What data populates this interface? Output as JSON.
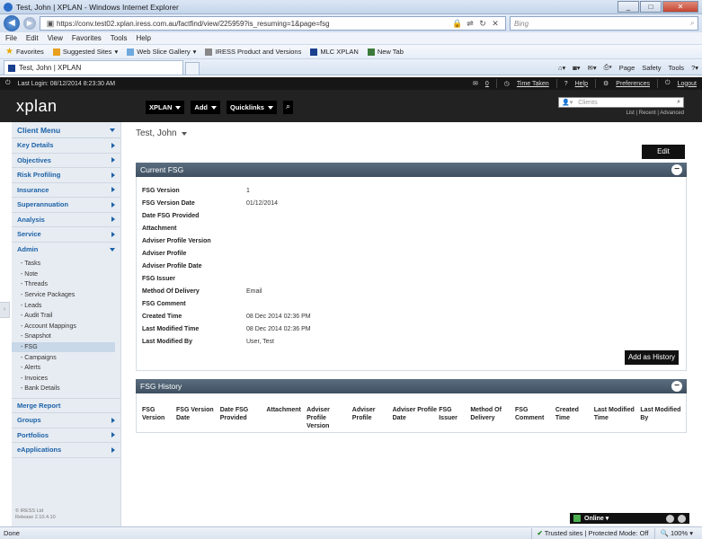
{
  "browser": {
    "title": "Test, John | XPLAN - Windows Internet Explorer",
    "url": "https://conv.test02.xplan.iress.com.au/factfind/view/225959?is_resuming=1&page=fsg",
    "search_placeholder": "Bing",
    "menu": [
      "File",
      "Edit",
      "View",
      "Favorites",
      "Tools",
      "Help"
    ],
    "favorites_label": "Favorites",
    "favorites": [
      "Suggested Sites",
      "Web Slice Gallery",
      "IRESS Product and Versions",
      "MLC XPLAN",
      "New Tab"
    ],
    "tab_title": "Test, John | XPLAN",
    "toolbar": [
      "Page",
      "Safety",
      "Tools"
    ],
    "status_left": "Done",
    "status_zone": "Trusted sites | Protected Mode: Off",
    "zoom": "100%"
  },
  "app": {
    "last_login": "Last Login: 08/12/2014 8:23:30 AM",
    "mail_count": "0",
    "time_taken": "Time Taken",
    "help": "Help",
    "preferences": "Preferences",
    "logout": "Logout",
    "logo": "xplan",
    "nav": [
      "XPLAN",
      "Add",
      "Quicklinks"
    ],
    "client_search_placeholder": "Clients",
    "search_links": "List  |  Recent  |  Advanced",
    "copyright": "© IRESS Ltd",
    "release": "Release 2.10.4.10",
    "online": "Online"
  },
  "sidebar": {
    "header": "Client Menu",
    "items_top": [
      "Key Details",
      "Objectives",
      "Risk Profiling",
      "Insurance",
      "Superannuation",
      "Analysis",
      "Service"
    ],
    "admin": "Admin",
    "admin_sub": [
      "Tasks",
      "Note",
      "Threads",
      "Service Packages",
      "Leads",
      "Audit Trail",
      "Account Mappings",
      "Snapshot",
      "FSG",
      "Campaigns",
      "Alerts",
      "Invoices",
      "Bank Details"
    ],
    "active_sub": "FSG",
    "merge_report": "Merge Report",
    "items_bottom": [
      "Groups",
      "Portfolios",
      "eApplications"
    ]
  },
  "main": {
    "client_name": "Test, John",
    "edit_label": "Edit",
    "current_fsg_title": "Current FSG",
    "fields": [
      {
        "label": "FSG Version",
        "value": "1"
      },
      {
        "label": "FSG Version Date",
        "value": "01/12/2014"
      },
      {
        "label": "Date FSG Provided",
        "value": ""
      },
      {
        "label": "Attachment",
        "value": ""
      },
      {
        "label": "Adviser Profile Version",
        "value": ""
      },
      {
        "label": "Adviser Profile",
        "value": ""
      },
      {
        "label": "Adviser Profile Date",
        "value": ""
      },
      {
        "label": "FSG Issuer",
        "value": ""
      },
      {
        "label": "Method Of Delivery",
        "value": "Email"
      },
      {
        "label": "FSG Comment",
        "value": ""
      },
      {
        "label": "Created Time",
        "value": "08 Dec 2014 02:36 PM"
      },
      {
        "label": "Last Modified Time",
        "value": "08 Dec 2014 02:36 PM"
      },
      {
        "label": "Last Modified By",
        "value": "User, Test"
      }
    ],
    "add_history": "Add as History",
    "history_title": "FSG History",
    "history_columns": [
      "FSG Version",
      "FSG Version Date",
      "Date FSG Provided",
      "Attachment",
      "Adviser Profile Version",
      "Adviser Profile",
      "Adviser Profile Date",
      "FSG Issuer",
      "Method Of Delivery",
      "FSG Comment",
      "Created Time",
      "Last Modified Time",
      "Last Modified By"
    ]
  }
}
